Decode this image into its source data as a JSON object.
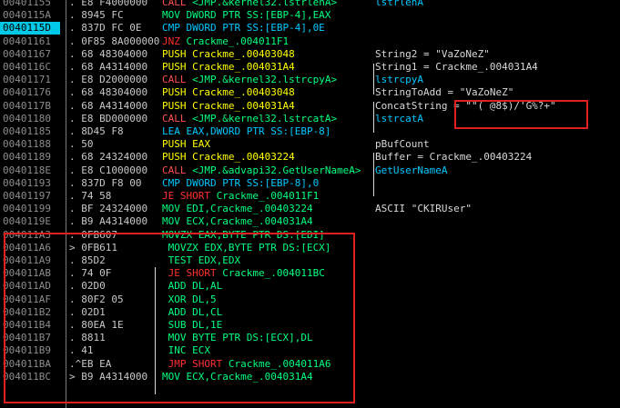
{
  "rows": [
    {
      "addr": "00401155",
      "hex": ". E8 F4000000",
      "asm": [
        {
          "t": "CALL",
          "c": "k-call"
        },
        {
          "t": " <JMP.&kernel32.lstrlenA>",
          "c": "t-green"
        }
      ],
      "cmt": "lstrlenA",
      "cmtc": "t-cyan"
    },
    {
      "addr": "0040115A",
      "hex": ". 8945 FC",
      "asm": [
        {
          "t": "MOV DWORD PTR SS:[EBP-4],EAX",
          "c": "t-green"
        }
      ],
      "cmt": "",
      "cmtc": ""
    },
    {
      "addr": "0040115D",
      "hex": ". 837D FC 0E",
      "asm": [
        {
          "t": "CMP DWORD PTR SS:[EBP-4],0E",
          "c": "t-cyan"
        }
      ],
      "cmt": "",
      "cmtc": "",
      "sel": true
    },
    {
      "addr": "00401161",
      "hex": ". 0F85 8A000000",
      "asm": [
        {
          "t": "JNZ",
          "c": "k-je"
        },
        {
          "t": " Crackme_.004011F1",
          "c": "t-green"
        }
      ],
      "cmt": "",
      "cmtc": ""
    },
    {
      "addr": "00401167",
      "hex": ". 68 48304000",
      "asm": [
        {
          "t": "PUSH Crackme_.00403048",
          "c": "t-yellow"
        }
      ],
      "cmt": "String2 = \"VaZoNeZ\"",
      "cmtc": "t-white"
    },
    {
      "addr": "0040116C",
      "hex": ". 68 A4314000",
      "asm": [
        {
          "t": "PUSH Crackme_.004031A4",
          "c": "t-yellow"
        }
      ],
      "cmt": "String1 = Crackme_.004031A4",
      "cmtc": "t-white"
    },
    {
      "addr": "00401171",
      "hex": ". E8 D2000000",
      "asm": [
        {
          "t": "CALL",
          "c": "k-call"
        },
        {
          "t": " <JMP.&kernel32.lstrcpyA>",
          "c": "t-green"
        }
      ],
      "cmt": "lstrcpyA",
      "cmtc": "t-cyan"
    },
    {
      "addr": "00401176",
      "hex": ". 68 48304000",
      "asm": [
        {
          "t": "PUSH Crackme_.00403048",
          "c": "t-yellow"
        }
      ],
      "cmt": "StringToAdd = \"VaZoNeZ\"",
      "cmtc": "t-white"
    },
    {
      "addr": "0040117B",
      "hex": ". 68 A4314000",
      "asm": [
        {
          "t": "PUSH Crackme_.004031A4",
          "c": "t-yellow"
        }
      ],
      "cmt": "ConcatString = \"\"( @8$)/'G%?+\"",
      "cmtc": "t-white"
    },
    {
      "addr": "00401180",
      "hex": ". E8 BD000000",
      "asm": [
        {
          "t": "CALL",
          "c": "k-call"
        },
        {
          "t": " <JMP.&kernel32.lstrcatA>",
          "c": "t-green"
        }
      ],
      "cmt": "lstrcatA",
      "cmtc": "t-cyan"
    },
    {
      "addr": "00401185",
      "hex": ". 8D45 F8",
      "asm": [
        {
          "t": "LEA EAX,DWORD PTR SS:[EBP-8]",
          "c": "t-cyan"
        }
      ],
      "cmt": "",
      "cmtc": ""
    },
    {
      "addr": "00401188",
      "hex": ". 50",
      "asm": [
        {
          "t": "PUSH EAX",
          "c": "t-yellow"
        }
      ],
      "cmt": "pBufCount",
      "cmtc": "t-white"
    },
    {
      "addr": "00401189",
      "hex": ". 68 24324000",
      "asm": [
        {
          "t": "PUSH Crackme_.00403224",
          "c": "t-yellow"
        }
      ],
      "cmt": "Buffer = Crackme_.00403224",
      "cmtc": "t-white"
    },
    {
      "addr": "0040118E",
      "hex": ". E8 C1000000",
      "asm": [
        {
          "t": "CALL",
          "c": "k-call"
        },
        {
          "t": " <JMP.&advapi32.GetUserNameA>",
          "c": "t-green"
        }
      ],
      "cmt": "GetUserNameA",
      "cmtc": "t-cyan"
    },
    {
      "addr": "00401193",
      "hex": ". 837D F8 00",
      "asm": [
        {
          "t": "CMP DWORD PTR SS:[EBP-8],0",
          "c": "t-cyan"
        }
      ],
      "cmt": "",
      "cmtc": ""
    },
    {
      "addr": "00401197",
      "hex": ". 74 58",
      "asm": [
        {
          "t": "JE SHORT",
          "c": "k-je"
        },
        {
          "t": " Crackme_.004011F1",
          "c": "t-green"
        }
      ],
      "cmt": "",
      "cmtc": ""
    },
    {
      "addr": "00401199",
      "hex": ". BF 24324000",
      "asm": [
        {
          "t": "MOV EDI,Crackme_.00403224",
          "c": "t-green"
        }
      ],
      "cmt": "ASCII \"CKIRUser\"",
      "cmtc": "t-white"
    },
    {
      "addr": "0040119E",
      "hex": ". B9 A4314000",
      "asm": [
        {
          "t": "MOV ECX,Crackme_.004031A4",
          "c": "t-green"
        }
      ],
      "cmt": "",
      "cmtc": ""
    },
    {
      "addr": "004011A3",
      "hex": ". 0FB607",
      "asm": [
        {
          "t": "MOVZX EAX,BYTE PTR DS:[EDI]",
          "c": "t-green"
        }
      ],
      "cmt": "",
      "cmtc": ""
    },
    {
      "addr": "004011A6",
      "hex": "> 0FB611",
      "asm": [
        {
          "t": " MOVZX EDX,BYTE PTR DS:[ECX]",
          "c": "t-green"
        }
      ],
      "cmt": "",
      "cmtc": ""
    },
    {
      "addr": "004011A9",
      "hex": ". 85D2",
      "asm": [
        {
          "t": " TEST EDX,EDX",
          "c": "t-green"
        }
      ],
      "cmt": "",
      "cmtc": ""
    },
    {
      "addr": "004011AB",
      "hex": ". 74 0F",
      "asm": [
        {
          "t": " JE SHORT",
          "c": "k-je"
        },
        {
          "t": " Crackme_.004011BC",
          "c": "t-green"
        }
      ],
      "cmt": "",
      "cmtc": ""
    },
    {
      "addr": "004011AD",
      "hex": ". 02D0",
      "asm": [
        {
          "t": " ADD DL,AL",
          "c": "t-green"
        }
      ],
      "cmt": "",
      "cmtc": ""
    },
    {
      "addr": "004011AF",
      "hex": ". 80F2 05",
      "asm": [
        {
          "t": " XOR DL,5",
          "c": "t-green"
        }
      ],
      "cmt": "",
      "cmtc": ""
    },
    {
      "addr": "004011B2",
      "hex": ". 02D1",
      "asm": [
        {
          "t": " ADD DL,CL",
          "c": "t-green"
        }
      ],
      "cmt": "",
      "cmtc": ""
    },
    {
      "addr": "004011B4",
      "hex": ". 80EA 1E",
      "asm": [
        {
          "t": " SUB DL,1E",
          "c": "t-green"
        }
      ],
      "cmt": "",
      "cmtc": ""
    },
    {
      "addr": "004011B7",
      "hex": ". 8811",
      "asm": [
        {
          "t": " MOV BYTE PTR DS:[ECX],DL",
          "c": "t-green"
        }
      ],
      "cmt": "",
      "cmtc": ""
    },
    {
      "addr": "004011B9",
      "hex": ". 41",
      "asm": [
        {
          "t": " INC ECX",
          "c": "t-green"
        }
      ],
      "cmt": "",
      "cmtc": ""
    },
    {
      "addr": "004011BA",
      "hex": ".^EB EA",
      "asm": [
        {
          "t": " JMP SHORT",
          "c": "k-je"
        },
        {
          "t": " Crackme_.004011A6",
          "c": "t-green"
        }
      ],
      "cmt": "",
      "cmtc": ""
    },
    {
      "addr": "004011BC",
      "hex": "> B9 A4314000",
      "asm": [
        {
          "t": "MOV ECX,Crackme_.004031A4",
          "c": "t-green"
        }
      ],
      "cmt": "",
      "cmtc": ""
    }
  ],
  "colors": {
    "selected_row_bg": "#00c8e6",
    "highlight_box": "#e02020"
  }
}
